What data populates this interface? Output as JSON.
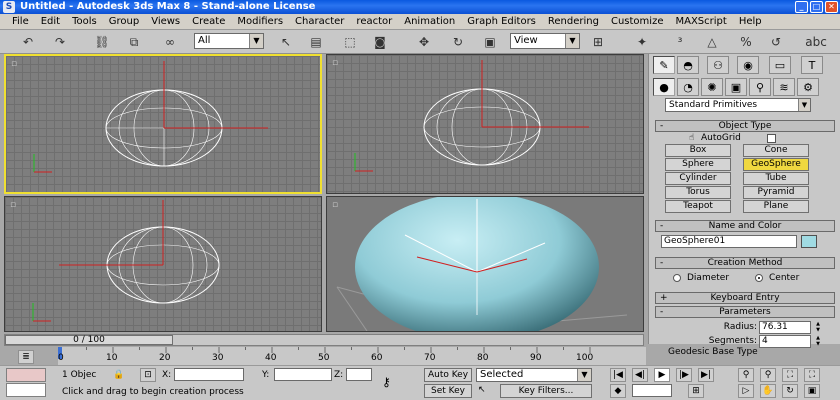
{
  "window": {
    "title": "Untitled - Autodesk 3ds Max 8 - Stand-alone License"
  },
  "menu": [
    "File",
    "Edit",
    "Tools",
    "Group",
    "Views",
    "Create",
    "Modifiers",
    "Character",
    "reactor",
    "Animation",
    "Graph Editors",
    "Rendering",
    "Customize",
    "MAXScript",
    "Help"
  ],
  "toolbar": {
    "selection_filter": "All",
    "reference_coord": "View"
  },
  "panel": {
    "category": "Standard Primitives",
    "object_type": {
      "title": "Object Type",
      "autogrid": "AutoGrid",
      "buttons": [
        "Box",
        "Cone",
        "Sphere",
        "GeoSphere",
        "Cylinder",
        "Tube",
        "Torus",
        "Pyramid",
        "Teapot",
        "Plane"
      ]
    },
    "name_color": {
      "title": "Name and Color",
      "name": "GeoSphere01",
      "color": "#a0dbe3"
    },
    "creation_method": {
      "title": "Creation Method",
      "diameter": "Diameter",
      "center": "Center"
    },
    "keyboard_entry": {
      "title": "Keyboard Entry"
    },
    "parameters": {
      "title": "Parameters",
      "radius_label": "Radius:",
      "radius": "76.31",
      "segments_label": "Segments:",
      "segments": "4",
      "geodesic_label": "Geodesic Base Type"
    }
  },
  "timeline": {
    "slider": "0 / 100",
    "ticks": [
      "0",
      "10",
      "20",
      "30",
      "40",
      "50",
      "60",
      "70",
      "80",
      "90",
      "100"
    ]
  },
  "status": {
    "selection": "1 Objec",
    "x_label": "X:",
    "y_label": "Y:",
    "z_label": "Z:",
    "prompt": "Click and drag to begin creation process",
    "auto_key": "Auto Key",
    "set_key": "Set Key",
    "key_mode": "Selected",
    "key_filters": "Key Filters..."
  },
  "colors": {
    "active_viewport": "#f0e030",
    "geosphere": "#a0dbe3"
  }
}
